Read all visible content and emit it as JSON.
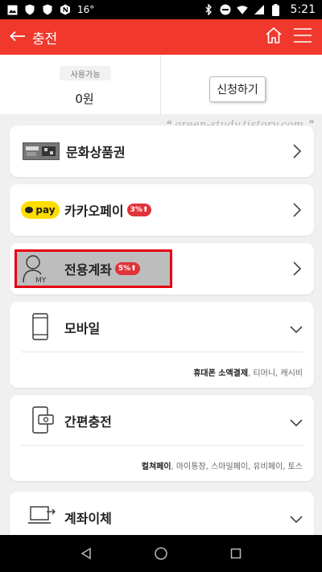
{
  "status_bar": {
    "temperature": "16°",
    "time": "5:21"
  },
  "header": {
    "title": "충전"
  },
  "balance": {
    "badge": "사용가능",
    "amount": "0원",
    "apply_label": "신청하기"
  },
  "watermark": "green-study.tistory.com",
  "methods": [
    {
      "title": "문화상품권"
    },
    {
      "title": "카카오페이",
      "pay_label": "pay",
      "badge": "3%⬆"
    },
    {
      "title": "전용계좌",
      "badge": "5%⬆",
      "icon_text": "MY"
    },
    {
      "title": "모바일",
      "desc_bold": "휴대폰 소액결제",
      "desc_rest": ", 티머니, 캐시비"
    },
    {
      "title": "간편충전",
      "desc_bold": "컬쳐페이",
      "desc_rest": ", 마이통장, 스마일페이, 유비페이, 토스"
    },
    {
      "title": "계좌이체"
    }
  ],
  "colors": {
    "header_red": "#f0382d",
    "highlight_border": "#e60012",
    "kakao_yellow": "#ffdd00",
    "badge_red": "#e0333a"
  },
  "icons": [
    "gallery-icon",
    "shield-icon",
    "shield-icon",
    "n-app-icon",
    "bluetooth-icon",
    "do-not-disturb-icon",
    "wifi-icon",
    "signal-icon",
    "battery-icon",
    "back-arrow-icon",
    "home-icon",
    "menu-icon",
    "chevron-right-icon",
    "chevron-down-icon",
    "nav-back-icon",
    "nav-home-icon",
    "nav-recents-icon"
  ]
}
